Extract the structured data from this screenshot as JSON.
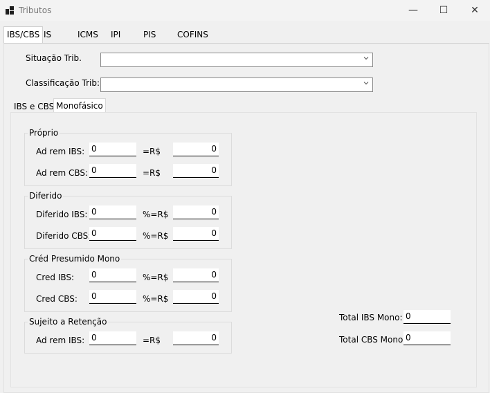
{
  "window": {
    "title": "Tributos",
    "minimize": "—",
    "maximize": "☐",
    "close": "✕"
  },
  "tabs": [
    "IBS/CBS",
    "IS",
    "ICMS",
    "IPI",
    "PIS",
    "COFINS"
  ],
  "form": {
    "situacao_label": "Situação Trib.",
    "situacao_value": "",
    "classificacao_label": "Classificação Trib:",
    "classificacao_value": ""
  },
  "subtabs": [
    "IBS e CBS",
    "Monofásico"
  ],
  "proprio": {
    "title": "Próprio",
    "rows": [
      {
        "label": "Ad rem IBS:",
        "value": "0",
        "op": "=R$",
        "result": "0"
      },
      {
        "label": "Ad rem CBS:",
        "value": "0",
        "op": "=R$",
        "result": "0"
      }
    ]
  },
  "diferido": {
    "title": "Diferido",
    "rows": [
      {
        "label": "Diferido IBS:",
        "value": "0",
        "op": "%=R$",
        "result": "0"
      },
      {
        "label": "Diferido CBS:",
        "value": "0",
        "op": "%=R$",
        "result": "0"
      }
    ]
  },
  "cred_presumido": {
    "title": "Créd Presumido Mono",
    "rows": [
      {
        "label": "Cred IBS:",
        "value": "0",
        "op": "%=R$",
        "result": "0"
      },
      {
        "label": "Cred CBS:",
        "value": "0",
        "op": "%=R$",
        "result": "0"
      }
    ]
  },
  "retencao": {
    "title": "Sujeito a Retenção",
    "rows": [
      {
        "label": "Ad rem IBS:",
        "value": "0",
        "op": "=R$",
        "result": "0"
      }
    ]
  },
  "totals": {
    "ibs_label": "Total IBS Mono:",
    "ibs_value": "0",
    "cbs_label": "Total CBS Mono:",
    "cbs_value": "0"
  }
}
